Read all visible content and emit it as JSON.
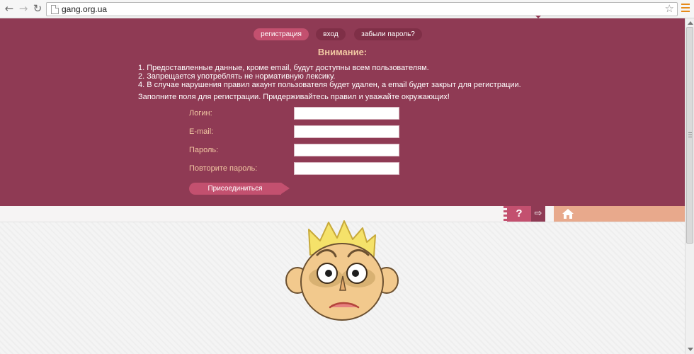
{
  "browser": {
    "url": "gang.org.ua",
    "back_icon": "back-arrow-icon",
    "forward_icon": "forward-arrow-icon",
    "reload_icon": "reload-icon",
    "bookmark_icon": "star-icon",
    "menu_icon": "hamburger-menu-icon"
  },
  "tabs": [
    {
      "label": "регистрация",
      "active": true
    },
    {
      "label": "вход",
      "active": false
    },
    {
      "label": "забыли пароль?",
      "active": false
    }
  ],
  "notice": {
    "title": "Внимание:",
    "rules": [
      "1. Предоставленные данные, кроме email, будут доступны всем пользователям.",
      "2. Запрещается употреблять не нормативную лексику.",
      "4. В случае нарушения правил акаунт пользователя будет удален, а email будет закрыт для регистрации."
    ],
    "intro": "Заполните поля для регистрации. Придерживайтесь правил и уважайте окружающих!"
  },
  "form": {
    "fields": [
      {
        "label": "Логин:",
        "value": ""
      },
      {
        "label": "E-mail:",
        "value": ""
      },
      {
        "label": "Пароль:",
        "value": ""
      },
      {
        "label": "Повторите пароль:",
        "value": ""
      }
    ],
    "submit_label": "Присоединиться"
  },
  "toolbar": {
    "help_label": "?",
    "login_icon": "login-icon",
    "home_icon": "home-icon"
  },
  "colors": {
    "panel": "#8f3a54",
    "accent": "#c3506f",
    "label": "#f2c9a3",
    "home_bar": "#e8a98c"
  }
}
